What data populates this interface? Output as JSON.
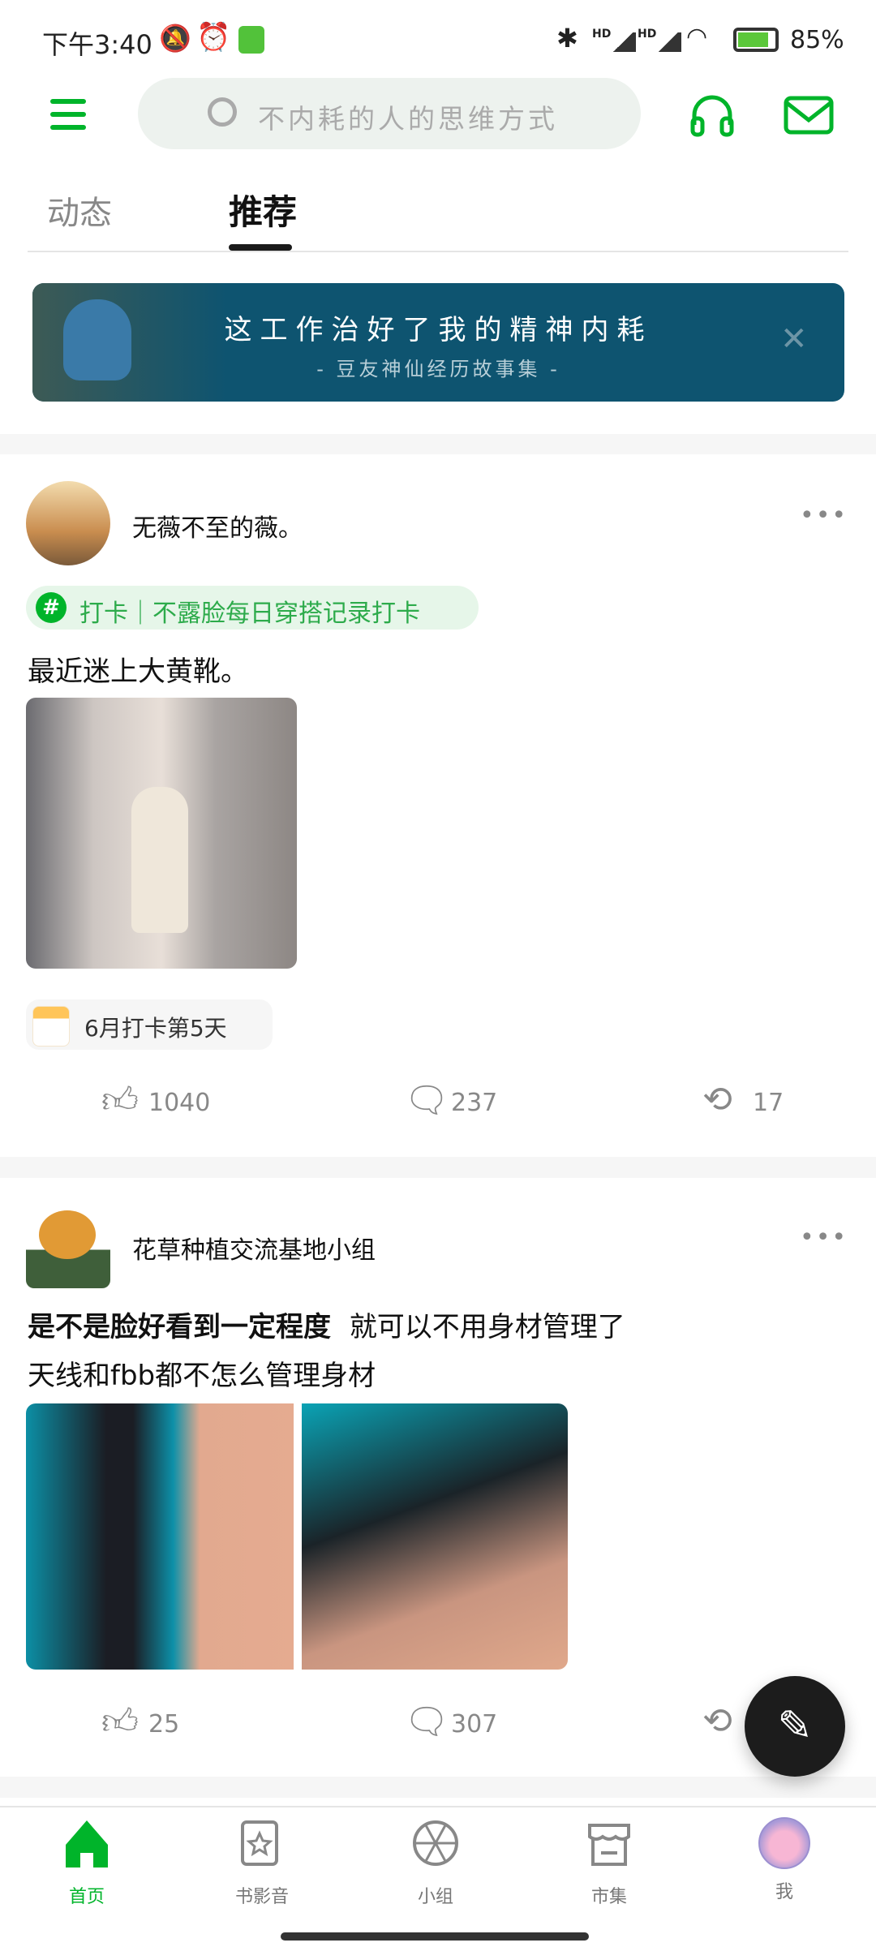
{
  "status_bar": {
    "time": "下午3:40",
    "battery": "85%",
    "network": "HD"
  },
  "header": {
    "search_placeholder": "不内耗的人的思维方式"
  },
  "tabs": [
    {
      "label": "动态",
      "active": false
    },
    {
      "label": "推荐",
      "active": true
    }
  ],
  "banner": {
    "title": "这工作治好了我的精神内耗",
    "subtitle": "- 豆友神仙经历故事集 -",
    "bg": "#0e5470"
  },
  "posts": [
    {
      "author": "无薇不至的薇。",
      "topic": "打卡｜不露脸每日穿搭记录打卡",
      "text": "最近迷上大黄靴。",
      "checkin": "6月打卡第5天",
      "likes": "1040",
      "comments": "237",
      "reposts": "17"
    },
    {
      "author": "花草种植交流基地小组",
      "title_bold": "是不是脸好看到一定程度",
      "title_rest": "就可以不用身材管理了",
      "text": "天线和fbb都不怎么管理身材",
      "likes": "25",
      "comments": "307"
    }
  ],
  "nav": [
    {
      "label": "首页",
      "active": true
    },
    {
      "label": "书影音"
    },
    {
      "label": "小组"
    },
    {
      "label": "市集"
    },
    {
      "label": "我"
    }
  ],
  "colors": {
    "accent": "#00b42a",
    "topic_bg": "#e6f6e9",
    "topic_text": "#2dab4b"
  }
}
